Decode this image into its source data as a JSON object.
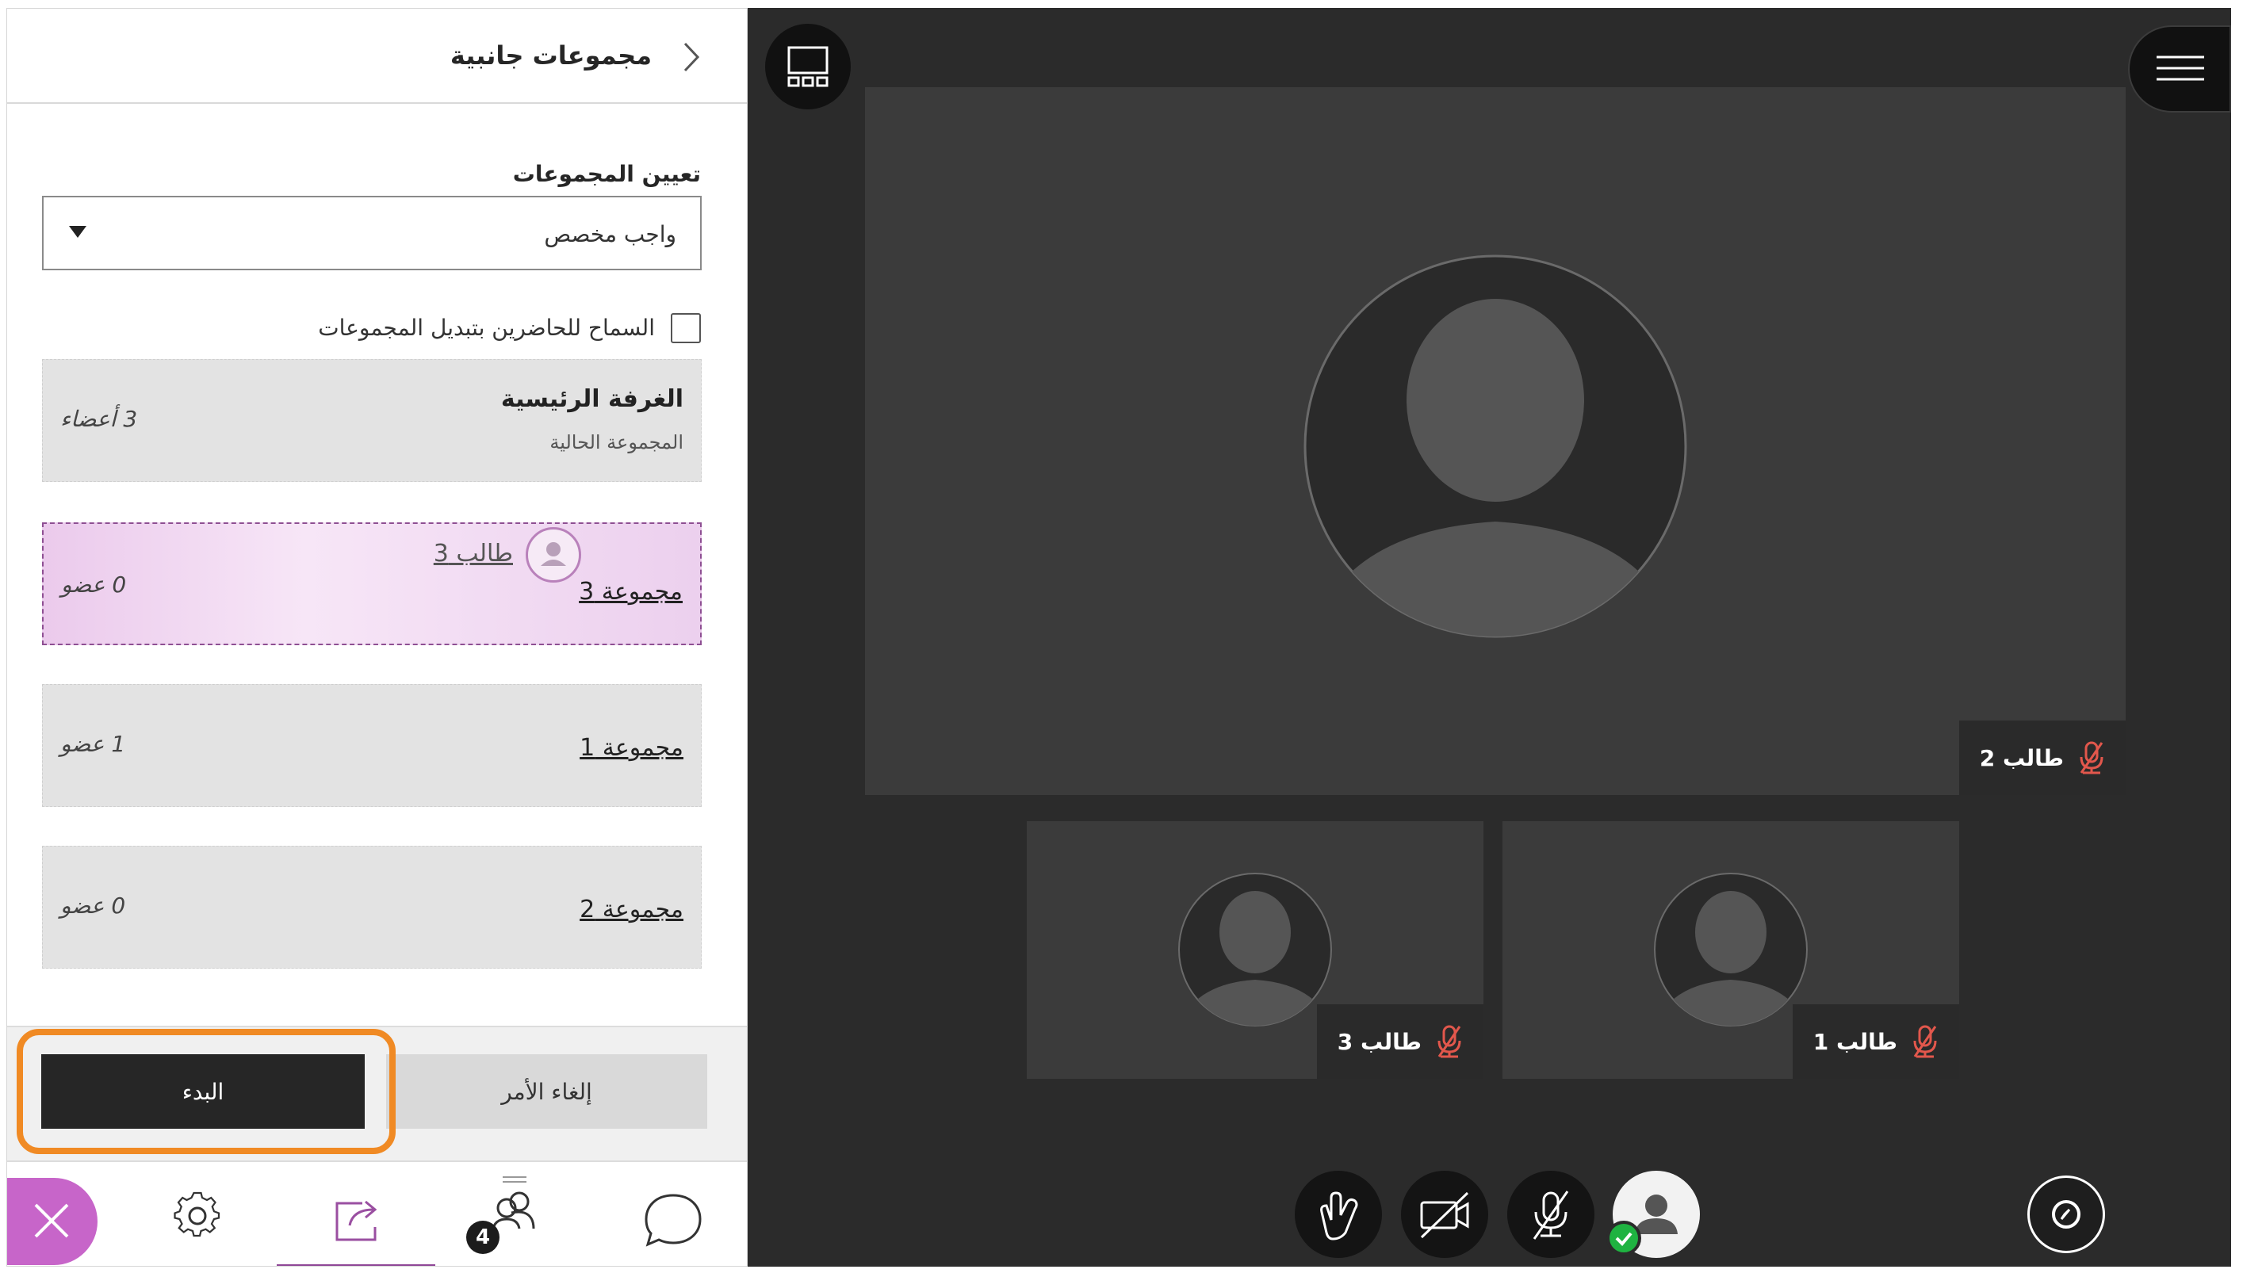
{
  "panel": {
    "title": "مجموعات جانبية",
    "assign_label": "تعيين المجموعات",
    "assign_value": "واجب مخصص",
    "allow_switch_label": "السماح للحاضرين بتبديل المجموعات",
    "main_room": {
      "name": "الغرفة الرئيسية",
      "sub": "المجموعة الحالية",
      "count": "3 أعضاء"
    },
    "groups": [
      {
        "name": "مجموعة 3",
        "count": "0 عضو",
        "dragged_member": "طالب 3"
      },
      {
        "name": "مجموعة 1",
        "count": "1 عضو"
      },
      {
        "name": "مجموعة 2",
        "count": "0 عضو"
      }
    ],
    "cancel_label": "إلغاء الأمر",
    "start_label": "البدء",
    "attendees_badge": "4"
  },
  "stage": {
    "main_participant": "طالب 2",
    "tiles": [
      "طالب 3",
      "طالب 1"
    ]
  },
  "colors": {
    "accent_purple": "#8f4797",
    "close_button": "#c765c9",
    "highlight_orange": "#f08a24",
    "mic_off_red": "#e2574c",
    "status_green": "#1fb341"
  },
  "icons": [
    "chevron-right-icon",
    "dropdown-caret-icon",
    "checkbox-icon",
    "avatar-icon",
    "close-icon",
    "gear-icon",
    "share-icon",
    "attendees-icon",
    "chat-icon",
    "layout-icon",
    "hamburger-menu-icon",
    "mic-off-icon",
    "raise-hand-icon",
    "camera-off-icon",
    "status-icon",
    "check-icon"
  ]
}
